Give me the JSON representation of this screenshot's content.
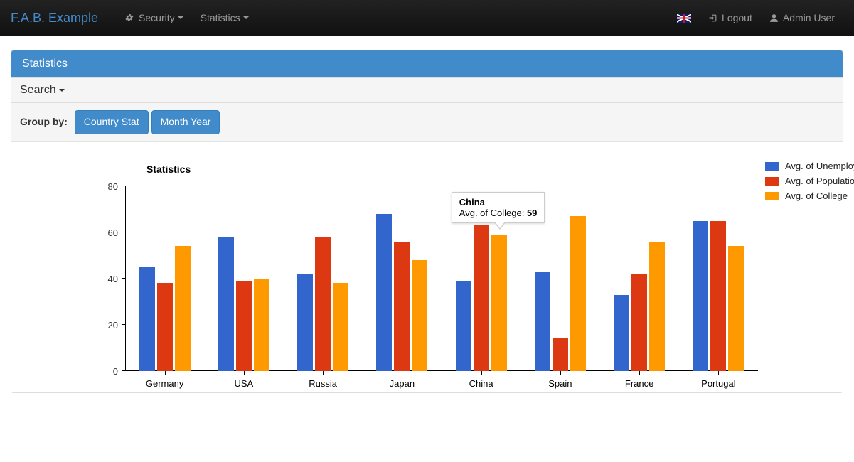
{
  "nav": {
    "brand": "F.A.B. Example",
    "security": "Security",
    "statistics": "Statistics",
    "logout": "Logout",
    "user": "Admin User"
  },
  "panel": {
    "title": "Statistics",
    "search": "Search",
    "groupby_label": "Group by:",
    "group_buttons": [
      "Country Stat",
      "Month Year"
    ]
  },
  "chart_data": {
    "type": "bar",
    "title": "Statistics",
    "ylabel": "",
    "ylim": [
      0,
      80
    ],
    "yticks": [
      0,
      20,
      40,
      60,
      80
    ],
    "categories": [
      "Germany",
      "USA",
      "Russia",
      "Japan",
      "China",
      "Spain",
      "France",
      "Portugal"
    ],
    "series": [
      {
        "name": "Avg. of Unemployed",
        "values": [
          45,
          58,
          42,
          68,
          39,
          43,
          33,
          65
        ]
      },
      {
        "name": "Avg. of Population",
        "values": [
          38,
          39,
          58,
          56,
          63,
          14,
          42,
          65
        ]
      },
      {
        "name": "Avg. of College",
        "values": [
          54,
          40,
          38,
          48,
          59,
          67,
          56,
          54
        ]
      }
    ],
    "tooltip": {
      "category": "China",
      "series": "Avg. of College",
      "value": 59
    }
  }
}
